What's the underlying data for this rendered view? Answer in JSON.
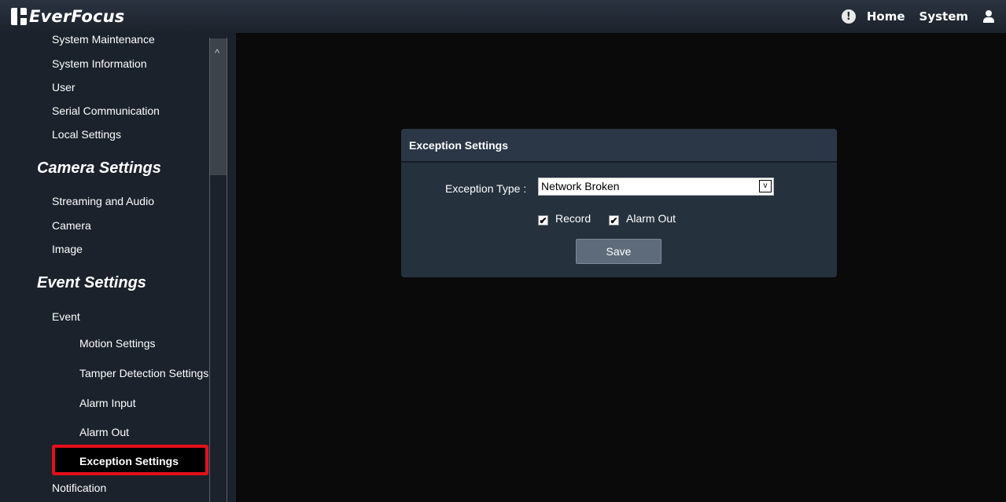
{
  "header": {
    "brand": "EverFocus",
    "nav": {
      "alert_icon": "!",
      "home": "Home",
      "system": "System"
    }
  },
  "sidebar": {
    "items_top": [
      "System Maintenance",
      "System Information",
      "User",
      "Serial Communication",
      "Local Settings"
    ],
    "camera_section": "Camera Settings",
    "camera_items": [
      "Streaming and Audio",
      "Camera",
      "Image"
    ],
    "event_section": "Event Settings",
    "event_item": "Event",
    "event_subitems": [
      "Motion Settings",
      "Tamper Detection Settings",
      "Alarm Input",
      "Alarm Out",
      "Exception Settings"
    ],
    "after_items": [
      "Notification"
    ],
    "scroll_up_icon": "^"
  },
  "panel": {
    "title": "Exception Settings",
    "exception_type_label": "Exception Type :",
    "exception_type_value": "Network Broken",
    "dropdown_icon": "v",
    "record_label": "Record",
    "record_checked": true,
    "alarm_out_label": "Alarm Out",
    "alarm_out_checked": true,
    "check_glyph": "✔",
    "save_label": "Save"
  },
  "colors": {
    "topbar": "#1f2731",
    "sidebar": "#1b222b",
    "main_bg": "#0a0a0a",
    "panel": "#26313e",
    "highlight": "#e3101a"
  }
}
